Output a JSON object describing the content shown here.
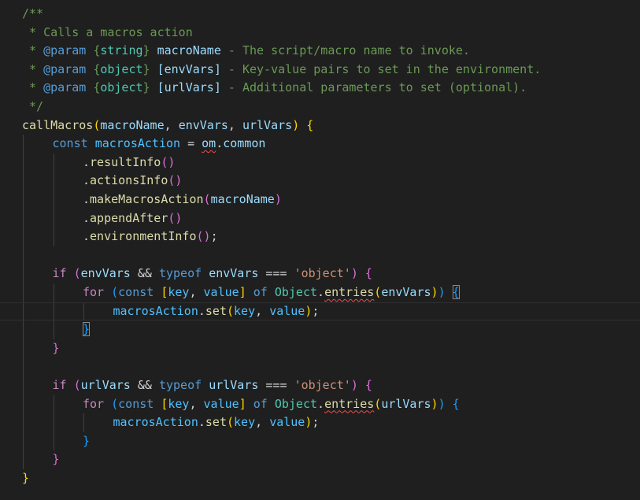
{
  "editor": {
    "lines": [
      {
        "indent": 0,
        "tokens": [
          [
            "/**",
            "comment"
          ]
        ]
      },
      {
        "indent": 0,
        "tokens": [
          [
            " * Calls a macros action",
            "comment"
          ]
        ]
      },
      {
        "indent": 0,
        "tokens": [
          [
            " * ",
            "comment"
          ],
          [
            "@param",
            "doctag"
          ],
          [
            " ",
            "comment"
          ],
          [
            "{",
            "comment"
          ],
          [
            "string",
            "type"
          ],
          [
            "}",
            "comment"
          ],
          [
            " ",
            "comment"
          ],
          [
            "macroName",
            "param"
          ],
          [
            " - The script/macro name to invoke.",
            "comment"
          ]
        ]
      },
      {
        "indent": 0,
        "tokens": [
          [
            " * ",
            "comment"
          ],
          [
            "@param",
            "doctag"
          ],
          [
            " ",
            "comment"
          ],
          [
            "{",
            "comment"
          ],
          [
            "object",
            "type"
          ],
          [
            "}",
            "comment"
          ],
          [
            " ",
            "comment"
          ],
          [
            "[envVars]",
            "param"
          ],
          [
            " - Key-value pairs to set in the environment.",
            "comment"
          ]
        ]
      },
      {
        "indent": 0,
        "tokens": [
          [
            " * ",
            "comment"
          ],
          [
            "@param",
            "doctag"
          ],
          [
            " ",
            "comment"
          ],
          [
            "{",
            "comment"
          ],
          [
            "object",
            "type"
          ],
          [
            "}",
            "comment"
          ],
          [
            " ",
            "comment"
          ],
          [
            "[urlVars]",
            "param"
          ],
          [
            " - Additional parameters to set (optional).",
            "comment"
          ]
        ]
      },
      {
        "indent": 0,
        "tokens": [
          [
            " */",
            "comment"
          ]
        ]
      },
      {
        "indent": 0,
        "tokens": [
          [
            "callMacros",
            "fn"
          ],
          [
            "(",
            "b1"
          ],
          [
            "macroName",
            "var"
          ],
          [
            ", ",
            "punct"
          ],
          [
            "envVars",
            "var"
          ],
          [
            ", ",
            "punct"
          ],
          [
            "urlVars",
            "var"
          ],
          [
            ")",
            "b1"
          ],
          [
            " ",
            "punct"
          ],
          [
            "{",
            "b1"
          ]
        ]
      },
      {
        "indent": 1,
        "tokens": [
          [
            "const",
            "keyword"
          ],
          [
            " ",
            "punct"
          ],
          [
            "macrosAction",
            "const"
          ],
          [
            " = ",
            "op"
          ],
          [
            "om",
            "var",
            "squiggle"
          ],
          [
            ".",
            "punct"
          ],
          [
            "common",
            "var"
          ]
        ]
      },
      {
        "indent": 2,
        "tokens": [
          [
            ".",
            "punct"
          ],
          [
            "resultInfo",
            "fn"
          ],
          [
            "()",
            "b2"
          ]
        ]
      },
      {
        "indent": 2,
        "tokens": [
          [
            ".",
            "punct"
          ],
          [
            "actionsInfo",
            "fn"
          ],
          [
            "()",
            "b2"
          ]
        ]
      },
      {
        "indent": 2,
        "tokens": [
          [
            ".",
            "punct"
          ],
          [
            "makeMacrosAction",
            "fn"
          ],
          [
            "(",
            "b2"
          ],
          [
            "macroName",
            "var"
          ],
          [
            ")",
            "b2"
          ]
        ]
      },
      {
        "indent": 2,
        "tokens": [
          [
            ".",
            "punct"
          ],
          [
            "appendAfter",
            "fn"
          ],
          [
            "()",
            "b2"
          ]
        ]
      },
      {
        "indent": 2,
        "tokens": [
          [
            ".",
            "punct"
          ],
          [
            "environmentInfo",
            "fn"
          ],
          [
            "()",
            "b2"
          ],
          [
            ";",
            "punct"
          ]
        ]
      },
      {
        "indent": 1,
        "tokens": []
      },
      {
        "indent": 1,
        "tokens": [
          [
            "if",
            "control"
          ],
          [
            " ",
            "punct"
          ],
          [
            "(",
            "b2"
          ],
          [
            "envVars",
            "var"
          ],
          [
            " && ",
            "op"
          ],
          [
            "typeof",
            "keyword"
          ],
          [
            " ",
            "punct"
          ],
          [
            "envVars",
            "var"
          ],
          [
            " === ",
            "op"
          ],
          [
            "'object'",
            "string"
          ],
          [
            ")",
            "b2"
          ],
          [
            " ",
            "punct"
          ],
          [
            "{",
            "b2"
          ]
        ]
      },
      {
        "indent": 2,
        "tokens": [
          [
            "for",
            "control"
          ],
          [
            " ",
            "punct"
          ],
          [
            "(",
            "b3"
          ],
          [
            "const",
            "keyword"
          ],
          [
            " ",
            "punct"
          ],
          [
            "[",
            "b1"
          ],
          [
            "key",
            "const"
          ],
          [
            ", ",
            "punct"
          ],
          [
            "value",
            "const"
          ],
          [
            "]",
            "b1"
          ],
          [
            " ",
            "punct"
          ],
          [
            "of",
            "keyword"
          ],
          [
            " ",
            "punct"
          ],
          [
            "Object",
            "class"
          ],
          [
            ".",
            "punct"
          ],
          [
            "entries",
            "fn",
            "squiggle"
          ],
          [
            "(",
            "b1"
          ],
          [
            "envVars",
            "var"
          ],
          [
            ")",
            "b1"
          ],
          [
            ")",
            "b3"
          ],
          [
            " ",
            "punct"
          ],
          [
            "{",
            "b3",
            "bracket-match"
          ]
        ]
      },
      {
        "indent": 3,
        "current": true,
        "tokens": [
          [
            "macrosAction",
            "const"
          ],
          [
            ".",
            "punct"
          ],
          [
            "set",
            "fn"
          ],
          [
            "(",
            "b1"
          ],
          [
            "key",
            "const"
          ],
          [
            ", ",
            "punct"
          ],
          [
            "value",
            "const"
          ],
          [
            ")",
            "b1"
          ],
          [
            ";",
            "punct"
          ]
        ]
      },
      {
        "indent": 2,
        "tokens": [
          [
            "}",
            "b3",
            "bracket-match"
          ]
        ]
      },
      {
        "indent": 1,
        "tokens": [
          [
            "}",
            "b2"
          ]
        ]
      },
      {
        "indent": 1,
        "tokens": []
      },
      {
        "indent": 1,
        "tokens": [
          [
            "if",
            "control"
          ],
          [
            " ",
            "punct"
          ],
          [
            "(",
            "b2"
          ],
          [
            "urlVars",
            "var"
          ],
          [
            " && ",
            "op"
          ],
          [
            "typeof",
            "keyword"
          ],
          [
            " ",
            "punct"
          ],
          [
            "urlVars",
            "var"
          ],
          [
            " === ",
            "op"
          ],
          [
            "'object'",
            "string"
          ],
          [
            ")",
            "b2"
          ],
          [
            " ",
            "punct"
          ],
          [
            "{",
            "b2"
          ]
        ]
      },
      {
        "indent": 2,
        "tokens": [
          [
            "for",
            "control"
          ],
          [
            " ",
            "punct"
          ],
          [
            "(",
            "b3"
          ],
          [
            "const",
            "keyword"
          ],
          [
            " ",
            "punct"
          ],
          [
            "[",
            "b1"
          ],
          [
            "key",
            "const"
          ],
          [
            ", ",
            "punct"
          ],
          [
            "value",
            "const"
          ],
          [
            "]",
            "b1"
          ],
          [
            " ",
            "punct"
          ],
          [
            "of",
            "keyword"
          ],
          [
            " ",
            "punct"
          ],
          [
            "Object",
            "class"
          ],
          [
            ".",
            "punct"
          ],
          [
            "entries",
            "fn",
            "squiggle"
          ],
          [
            "(",
            "b1"
          ],
          [
            "urlVars",
            "var"
          ],
          [
            ")",
            "b1"
          ],
          [
            ")",
            "b3"
          ],
          [
            " ",
            "punct"
          ],
          [
            "{",
            "b3"
          ]
        ]
      },
      {
        "indent": 3,
        "tokens": [
          [
            "macrosAction",
            "const"
          ],
          [
            ".",
            "punct"
          ],
          [
            "set",
            "fn"
          ],
          [
            "(",
            "b1"
          ],
          [
            "key",
            "const"
          ],
          [
            ", ",
            "punct"
          ],
          [
            "value",
            "const"
          ],
          [
            ")",
            "b1"
          ],
          [
            ";",
            "punct"
          ]
        ]
      },
      {
        "indent": 2,
        "tokens": [
          [
            "}",
            "b3"
          ]
        ]
      },
      {
        "indent": 1,
        "tokens": [
          [
            "}",
            "b2"
          ]
        ]
      },
      {
        "indent": 0,
        "tokens": [
          [
            "}",
            "b1"
          ]
        ]
      }
    ]
  },
  "colors": {
    "background": "#1f1f1f",
    "comment": "#6a9955",
    "keyword": "#569cd6",
    "control": "#c586c0",
    "function": "#dcdcaa",
    "variable": "#9cdcfe",
    "constant": "#4fc1ff",
    "type": "#4ec9b0",
    "string": "#ce9178",
    "bracket_level_1": "#ffd700",
    "bracket_level_2": "#da70d6",
    "bracket_level_3": "#179fff",
    "error_squiggle": "#f14c4c"
  }
}
